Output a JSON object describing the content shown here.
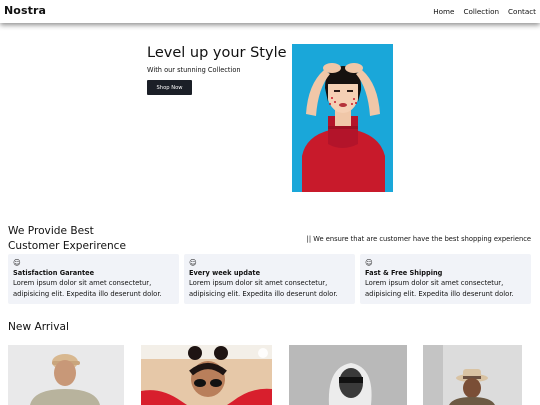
{
  "navbar": {
    "logo": "Nostra",
    "links": [
      "Home",
      "Collection",
      "Contact"
    ]
  },
  "hero": {
    "title": "Level up your Style",
    "subtitle": "With our stunning Collection",
    "button_label": "Shop Now"
  },
  "provide": {
    "title_line1": "We Provide Best",
    "title_line2": "Customer Experirence",
    "note": "|| We ensure that are customer have the best shopping experience",
    "features": [
      {
        "icon": "smiley-icon",
        "glyph": "☺",
        "title": "Satisfaction Garantee",
        "text_line1": "Lorem ipsum dolor sit amet consectetur,",
        "text_line2": "adipisicing elit. Expedita illo deserunt dolor."
      },
      {
        "icon": "smiley-icon",
        "glyph": "☺",
        "title": "Every week update",
        "text_line1": "Lorem ipsum dolor sit amet consectetur,",
        "text_line2": "adipisicing elit. Expedita illo deserunt dolor."
      },
      {
        "icon": "smiley-icon",
        "glyph": "☺",
        "title": "Fast & Free Shipping",
        "text_line1": "Lorem ipsum dolor sit amet consectetur,",
        "text_line2": "adipisicing elit. Expedita illo deserunt dolor."
      }
    ]
  },
  "arrivals": {
    "title": "New Arrival"
  },
  "colors": {
    "hero_bg": "#1aa7d9",
    "sweater": "#c81a2b",
    "button": "#1b1f27",
    "feature_bg": "#f1f3f8"
  }
}
